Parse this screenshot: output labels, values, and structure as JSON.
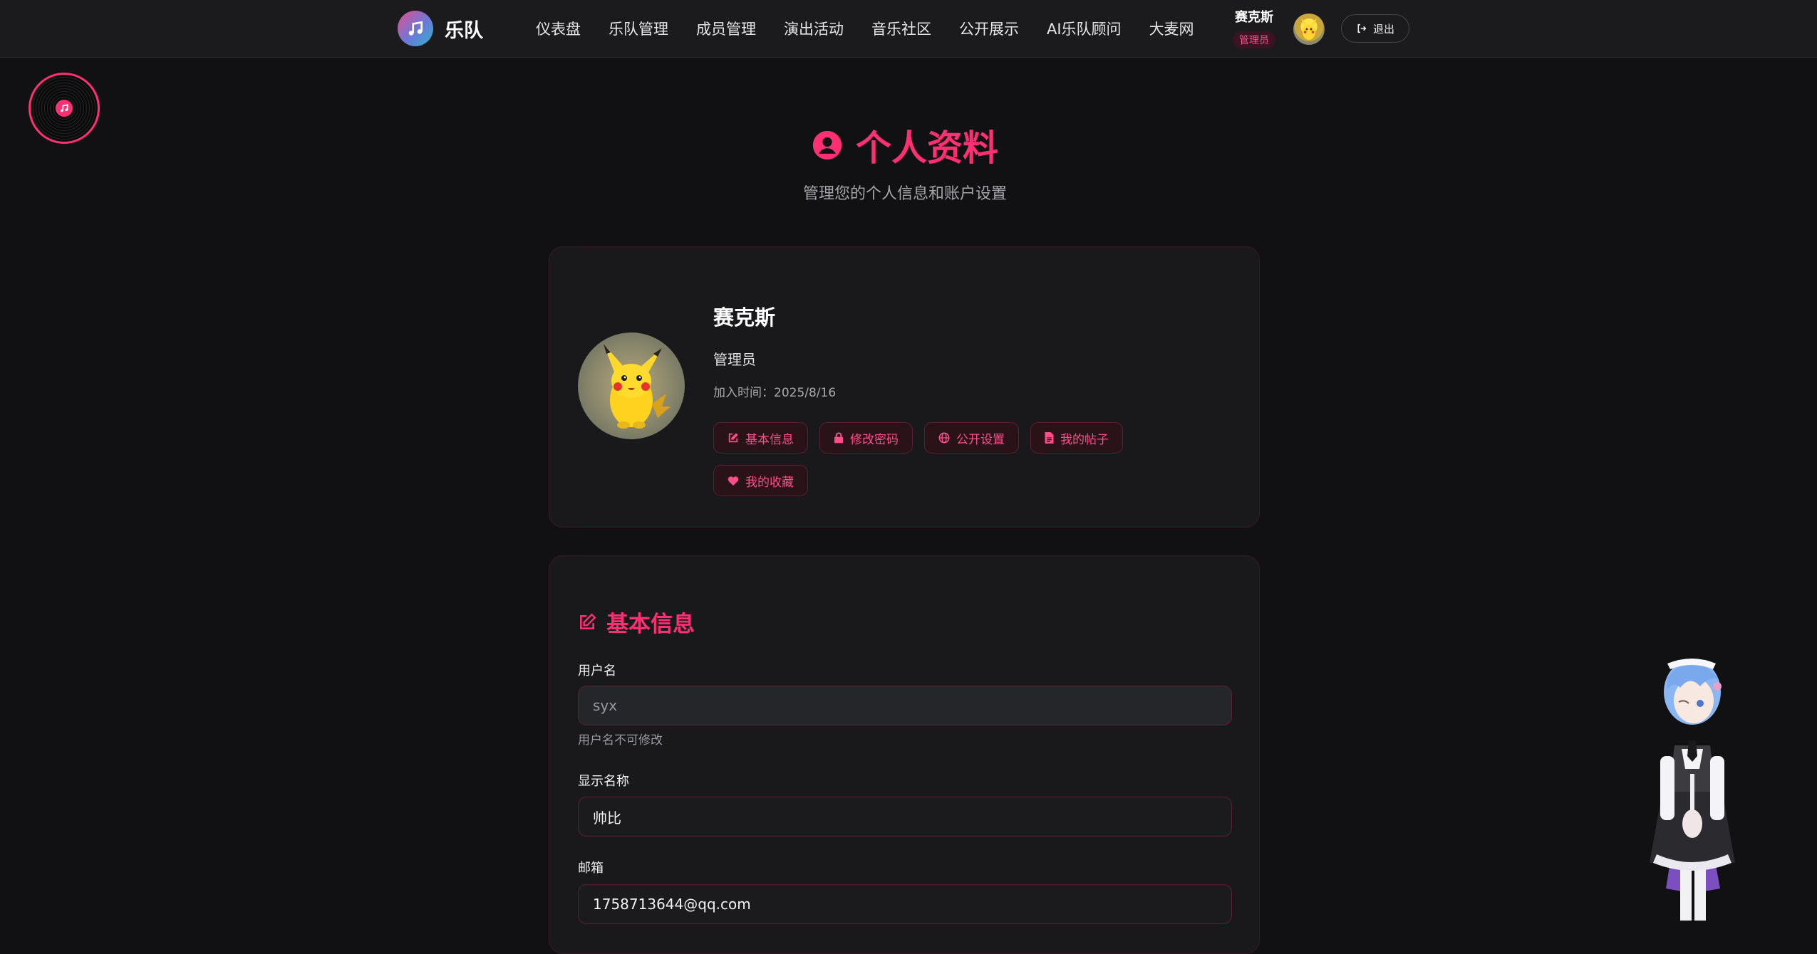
{
  "nav": {
    "brand": "乐队",
    "links": [
      "仪表盘",
      "乐队管理",
      "成员管理",
      "演出活动",
      "音乐社区",
      "公开展示",
      "AI乐队顾问",
      "大麦网"
    ],
    "user_name": "赛克斯",
    "user_role_badge": "管理员",
    "logout_label": "退出"
  },
  "header": {
    "title": "个人资料",
    "subtitle": "管理您的个人信息和账户设置"
  },
  "profile": {
    "name": "赛克斯",
    "role": "管理员",
    "join_time": "加入时间：2025/8/16",
    "tabs": [
      {
        "label": "基本信息",
        "icon": "edit-icon"
      },
      {
        "label": "修改密码",
        "icon": "lock-icon"
      },
      {
        "label": "公开设置",
        "icon": "globe-icon"
      },
      {
        "label": "我的帖子",
        "icon": "document-icon"
      },
      {
        "label": "我的收藏",
        "icon": "heart-icon"
      }
    ]
  },
  "basic_info": {
    "title": "基本信息",
    "username_label": "用户名",
    "username_value": "syx",
    "username_hint": "用户名不可修改",
    "display_name_label": "显示名称",
    "display_name_value": "帅比",
    "email_label": "邮箱",
    "email_value": "1758713644@qq.com"
  },
  "colors": {
    "accent": "#ff2f73",
    "background": "#111113",
    "card": "#19191b",
    "nav": "#1b1b1d"
  }
}
